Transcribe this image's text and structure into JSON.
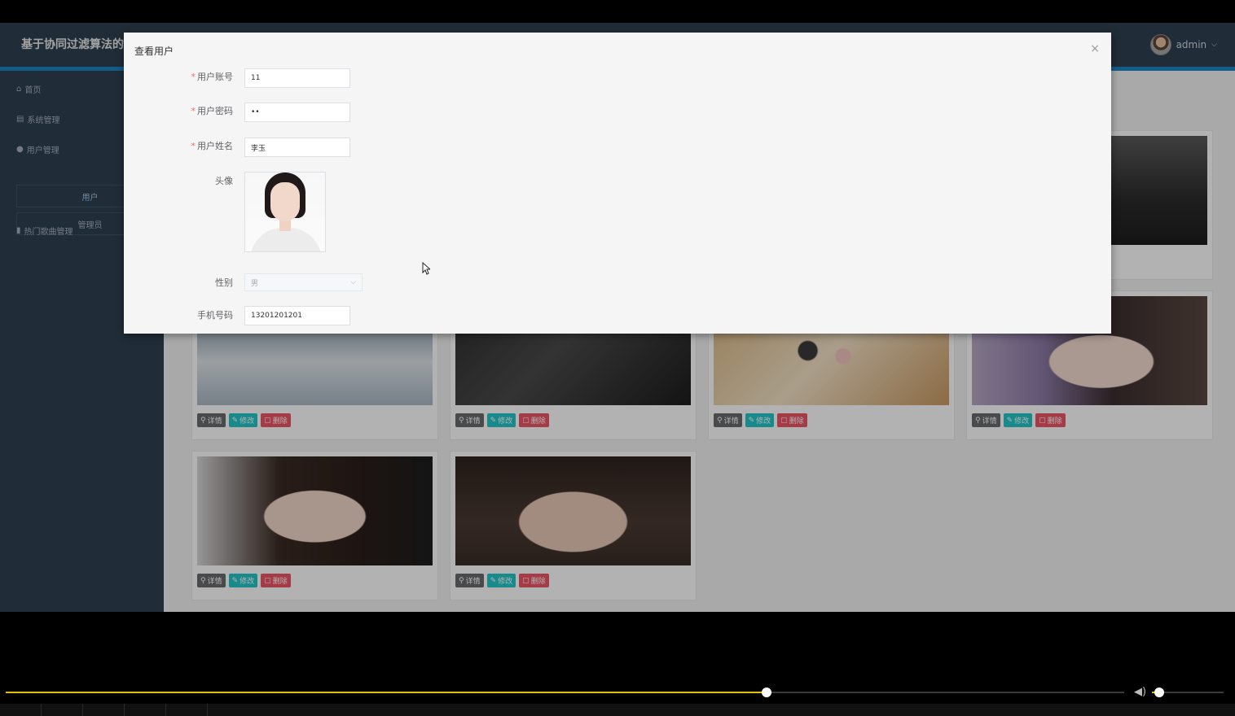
{
  "app": {
    "title": "基于协同过滤算法的",
    "user": "admin"
  },
  "sidebar": {
    "items": [
      {
        "label": "首页",
        "icon": "home-icon"
      },
      {
        "label": "系统管理",
        "icon": "database-icon"
      },
      {
        "label": "用户管理",
        "icon": "user-icon"
      },
      {
        "label": "热门歌曲管理",
        "icon": "music-icon"
      }
    ],
    "sub_items": [
      {
        "label": "用户",
        "active": true
      },
      {
        "label": "管理员",
        "active": false
      }
    ]
  },
  "cards": {
    "buttons": {
      "detail": "详情",
      "edit": "修改",
      "delete": "删除"
    }
  },
  "modal": {
    "title": "查看用户",
    "close": "×",
    "fields": {
      "account": {
        "label": "用户账号",
        "required": true,
        "value": "11"
      },
      "password": {
        "label": "用户密码",
        "required": true,
        "value": "••"
      },
      "name": {
        "label": "用户姓名",
        "required": true,
        "value": "李玉"
      },
      "avatar": {
        "label": "头像"
      },
      "gender": {
        "label": "性别",
        "value": "男"
      },
      "phone": {
        "label": "手机号码",
        "value": "13201201201"
      }
    }
  },
  "player": {
    "progress": 0.68,
    "volume": 0.1
  },
  "colors": {
    "sidebar": "#2f4050",
    "accent_bar": "#1c84c6",
    "btn_detail": "#676a6c",
    "btn_edit": "#23c6c8",
    "btn_delete": "#ed5565",
    "progress": "#e5c100"
  }
}
